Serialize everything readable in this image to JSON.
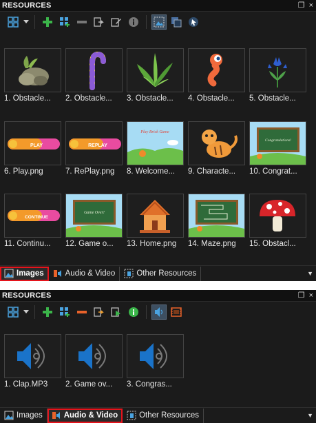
{
  "panel_top": {
    "title": "RESOURCES",
    "pin_icon": "pin-icon",
    "close_label": "×",
    "items": [
      {
        "label": "1. Obstacle..."
      },
      {
        "label": "2. Obstacle..."
      },
      {
        "label": "3. Obstacle..."
      },
      {
        "label": "4. Obstacle..."
      },
      {
        "label": "5. Obstacle..."
      },
      {
        "label": "6. Play.png",
        "button_text": "PLAY"
      },
      {
        "label": "7. RePlay.png",
        "button_text": "REPLAY"
      },
      {
        "label": "8. Welcome...",
        "banner_text": "Play Brick Game"
      },
      {
        "label": "9. Characte..."
      },
      {
        "label": "10. Congrat...",
        "board_text": "Congratulations!"
      },
      {
        "label": "11. Continu...",
        "button_text": "CONTINUE"
      },
      {
        "label": "12. Game o...",
        "board_text": "Game Over!"
      },
      {
        "label": "13. Home.png"
      },
      {
        "label": "14. Maze.png"
      },
      {
        "label": "15. Obstacl..."
      }
    ],
    "tabs": [
      {
        "label": "Images",
        "active": true
      },
      {
        "label": "Audio & Video",
        "active": false
      },
      {
        "label": "Other Resources",
        "active": false
      }
    ]
  },
  "panel_bottom": {
    "title": "RESOURCES",
    "close_label": "×",
    "items": [
      {
        "label": "1. Clap.MP3"
      },
      {
        "label": "2. Game ov..."
      },
      {
        "label": "3. Congras..."
      }
    ],
    "tabs": [
      {
        "label": "Images",
        "active": false
      },
      {
        "label": "Audio & Video",
        "active": true
      },
      {
        "label": "Other Resources",
        "active": false
      }
    ]
  },
  "colors": {
    "panel_bg": "#1b1b1b",
    "active_tab_outline": "#e5141c",
    "add_green": "#3bb54a",
    "remove_orange": "#e8622a",
    "speaker_blue": "#1a73c9"
  }
}
